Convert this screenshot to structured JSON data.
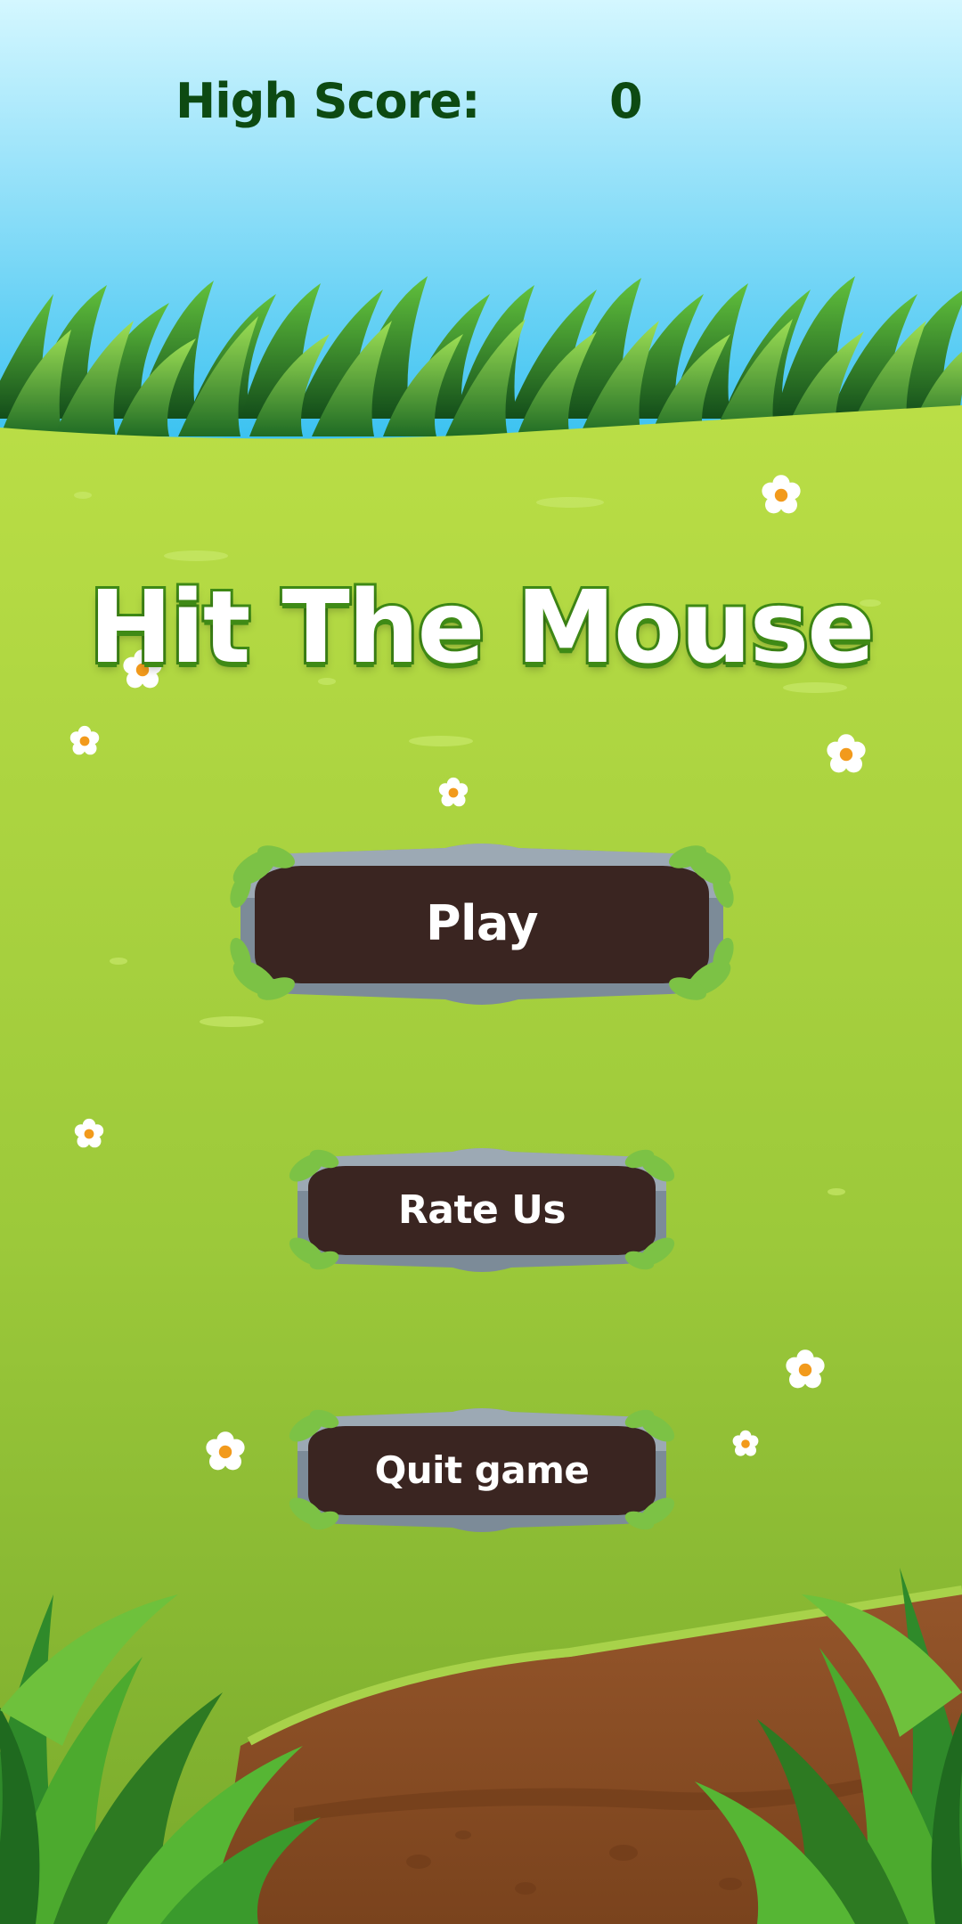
{
  "hud": {
    "high_score_label": "High Score:",
    "high_score_value": "0"
  },
  "title": "Hit The Mouse",
  "menu": {
    "play_label": "Play",
    "rate_label": "Rate Us",
    "quit_label": "Quit game"
  },
  "colors": {
    "sky_top": "#c9f3ff",
    "sky_bottom": "#37c3ef",
    "meadow_light": "#b7dc44",
    "meadow_dark": "#7aac2c",
    "hud_text": "#0d4a12",
    "button_body": "#3a2521",
    "button_rim": "#7b8a97",
    "dirt": "#8a4d22",
    "title_outline": "#3f8a16"
  }
}
